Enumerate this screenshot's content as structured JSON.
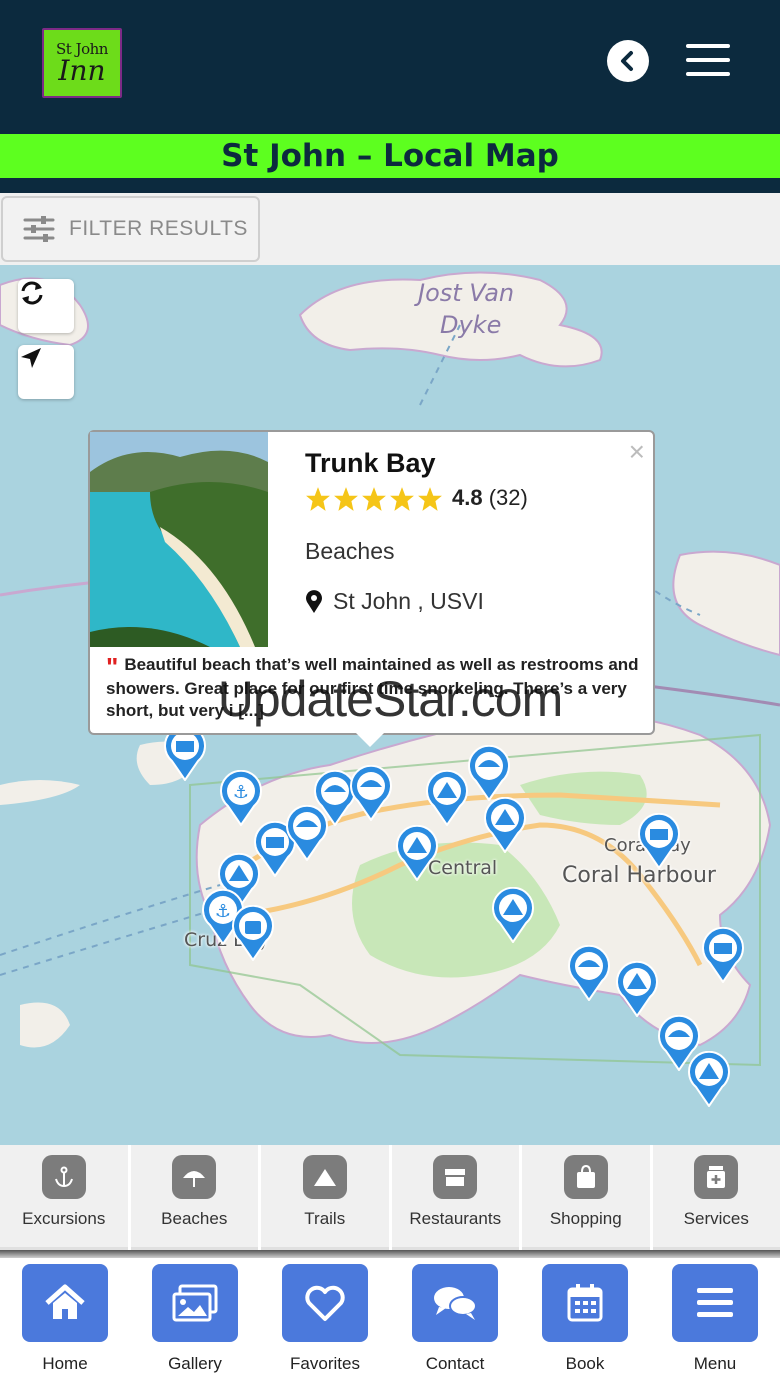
{
  "header": {
    "logo_top": "St John",
    "logo_bottom": "Inn",
    "back_icon": "chevron-left-icon",
    "menu_icon": "hamburger-icon"
  },
  "page_title": "St John – Local Map",
  "filter": {
    "label": "FILTER RESULTS",
    "icon": "sliders-icon"
  },
  "map": {
    "labels": {
      "island_top": "Jost Van",
      "island_top2": "Dyke",
      "central": "Central",
      "coral_harbour": "Coral Harbour",
      "coral_bay": "Coral Bay",
      "cruz_bay": "Cruz Bay"
    },
    "controls": {
      "refresh_icon": "refresh-icon",
      "locate_icon": "location-arrow-icon"
    }
  },
  "popup": {
    "name": "Trunk Bay",
    "rating": "4.8",
    "reviews": "(32)",
    "stars": 5,
    "category": "Beaches",
    "location": "St John , USVI",
    "quote_mark": "\"",
    "quote": "Beautiful beach that’s well maintained as well as restrooms and showers. Great place for our first time snorkeling. There’s a very short, but very i [...]",
    "close": "×"
  },
  "watermark": "UpdateStar.com",
  "categories": [
    {
      "label": "Excursions",
      "icon": "anchor-icon"
    },
    {
      "label": "Beaches",
      "icon": "umbrella-icon"
    },
    {
      "label": "Trails",
      "icon": "mountain-icon"
    },
    {
      "label": "Restaurants",
      "icon": "store-icon"
    },
    {
      "label": "Shopping",
      "icon": "shopping-bag-icon"
    },
    {
      "label": "Services",
      "icon": "clinic-icon"
    }
  ],
  "bottom_nav": [
    {
      "label": "Home",
      "icon": "home-icon"
    },
    {
      "label": "Gallery",
      "icon": "gallery-icon"
    },
    {
      "label": "Favorites",
      "icon": "heart-icon"
    },
    {
      "label": "Contact",
      "icon": "chat-icon"
    },
    {
      "label": "Book",
      "icon": "calendar-icon"
    },
    {
      "label": "Menu",
      "icon": "menu-icon"
    }
  ],
  "colors": {
    "header_bg": "#0c2a3e",
    "title_green": "#5dff1f",
    "nav_blue": "#4b79dc",
    "pin_blue": "#2a8be0",
    "star_yellow": "#f5c518"
  }
}
